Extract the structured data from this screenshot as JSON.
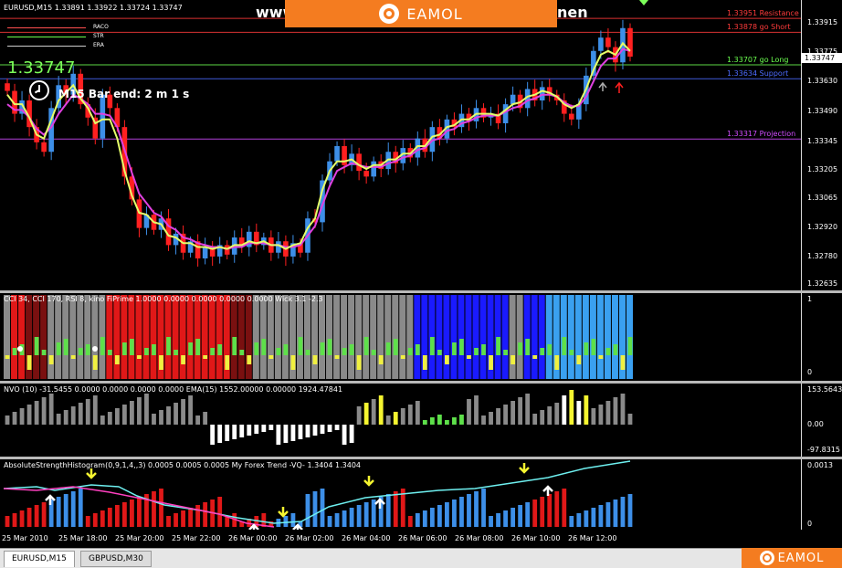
{
  "main": {
    "header": "EURUSD,M15  1.33891 1.33922 1.33724 1.33747",
    "big_price": "1.33747",
    "bar_end": "M15 Bar end: 2 m 1 s",
    "last_price_tag": "1.33747",
    "legend_items": [
      "RACO",
      "STR",
      "ERA"
    ],
    "levels": [
      {
        "label": "1.33951 Resistance",
        "value": 1.33951,
        "color": "#ff3b3b"
      },
      {
        "label": "1.33878 go Short",
        "value": 1.33878,
        "color": "#ff3b3b"
      },
      {
        "label": "1.33707 go Long",
        "value": 1.33707,
        "color": "#6bff4f"
      },
      {
        "label": "1.33634 Support",
        "value": 1.33634,
        "color": "#4d6bff"
      },
      {
        "label": "1.33317 Projection",
        "value": 1.33317,
        "color": "#d14cff"
      }
    ],
    "ticks": [
      "1.33915",
      "1.33775",
      "1.33630",
      "1.33490",
      "1.33345",
      "1.33205",
      "1.33065",
      "1.32920",
      "1.32780",
      "1.32635"
    ]
  },
  "watermark": {
    "url_left": "www",
    "url_right": "nen",
    "brand": "EAMOL"
  },
  "cci": {
    "title": "CCI 34, CCI 170, RSI 8, kino FiPrime  1.0000 0.0000 0.0000 0.0000 0.0000  Wick 3.1 -2.3",
    "ticks": [
      "1",
      "0"
    ]
  },
  "nvo": {
    "title": "NVO (10) -31.5455 0.0000 0.0000 0.0000 0.0000  EMA(15) 1552.00000 0.00000 1924.47841",
    "ticks": [
      "153.5643",
      "0.00",
      "-97.8315"
    ]
  },
  "ash": {
    "title": "AbsoluteStrengthHistogram(0,9,1,4,,3) 0.0005 0.0005 0.0005  My Forex Trend -VQ- 1.3404 1.3404",
    "ticks": [
      "0.0013",
      "0"
    ]
  },
  "time_axis": [
    "25 Mar 2010",
    "25 Mar 18:00",
    "25 Mar 20:00",
    "25 Mar 22:00",
    "26 Mar 00:00",
    "26 Mar 02:00",
    "26 Mar 04:00",
    "26 Mar 06:00",
    "26 Mar 08:00",
    "26 Mar 10:00",
    "26 Mar 12:00"
  ],
  "tabs": [
    {
      "label": "EURUSD,M15",
      "active": true
    },
    {
      "label": "GBPUSD,M30",
      "active": false
    }
  ],
  "chart_data": {
    "type": "candlestick",
    "symbol": "EURUSD",
    "timeframe": "M15",
    "ylim": [
      1.3257,
      1.3399
    ],
    "closes": [
      1.3357,
      1.3345,
      1.3352,
      1.3338,
      1.333,
      1.3325,
      1.3348,
      1.336,
      1.3355,
      1.3366,
      1.335,
      1.3343,
      1.3332,
      1.3355,
      1.3348,
      1.3338,
      1.3312,
      1.33,
      1.3285,
      1.3292,
      1.3284,
      1.329,
      1.3276,
      1.3282,
      1.3272,
      1.3278,
      1.3269,
      1.3275,
      1.327,
      1.3276,
      1.3271,
      1.328,
      1.3275,
      1.3283,
      1.3276,
      1.328,
      1.3272,
      1.3278,
      1.327,
      1.3277,
      1.3272,
      1.329,
      1.3288,
      1.331,
      1.332,
      1.3328,
      1.3318,
      1.3324,
      1.3315,
      1.3312,
      1.332,
      1.3316,
      1.3325,
      1.3319,
      1.3327,
      1.3322,
      1.3332,
      1.3325,
      1.3338,
      1.3332,
      1.3342,
      1.3338,
      1.3345,
      1.3341,
      1.3348,
      1.3343,
      1.3345,
      1.334,
      1.335,
      1.3355,
      1.3348,
      1.3358,
      1.3352,
      1.3359,
      1.3355,
      1.3352,
      1.3345,
      1.3342,
      1.335,
      1.3365,
      1.3378,
      1.3385,
      1.338,
      1.3372,
      1.339,
      1.3375
    ],
    "ema_fast": [
      1.3355,
      1.335,
      1.335,
      1.3343,
      1.3334,
      1.3332,
      1.3342,
      1.3352,
      1.3356,
      1.336,
      1.3353,
      1.3348,
      1.334,
      1.3342,
      1.3342,
      1.3332,
      1.3315,
      1.3302,
      1.3293,
      1.3292,
      1.3288,
      1.3287,
      1.3281,
      1.328,
      1.3277,
      1.3277,
      1.3275,
      1.3275,
      1.3274,
      1.3275,
      1.3274,
      1.3276,
      1.3276,
      1.3278,
      1.3277,
      1.3278,
      1.3276,
      1.3276,
      1.3274,
      1.3276,
      1.3277,
      1.3285,
      1.329,
      1.3305,
      1.3315,
      1.332,
      1.332,
      1.3321,
      1.3318,
      1.3316,
      1.3318,
      1.3318,
      1.3321,
      1.3321,
      1.3324,
      1.3324,
      1.3328,
      1.3328,
      1.3333,
      1.3334,
      1.3338,
      1.3339,
      1.3342,
      1.3342,
      1.3345,
      1.3345,
      1.3345,
      1.3344,
      1.3347,
      1.335,
      1.3351,
      1.3354,
      1.3355,
      1.3357,
      1.3356,
      1.3354,
      1.335,
      1.3348,
      1.335,
      1.3358,
      1.3368,
      1.3376,
      1.3378,
      1.3376,
      1.3382,
      1.3378
    ],
    "ema_slow": [
      1.335,
      1.3347,
      1.3347,
      1.3343,
      1.3337,
      1.3334,
      1.3338,
      1.3345,
      1.335,
      1.3355,
      1.3353,
      1.335,
      1.3345,
      1.3345,
      1.3344,
      1.3338,
      1.3326,
      1.3314,
      1.3303,
      1.3298,
      1.3293,
      1.3291,
      1.3286,
      1.3284,
      1.328,
      1.3279,
      1.3277,
      1.3276,
      1.3275,
      1.3275,
      1.3274,
      1.3275,
      1.3275,
      1.3277,
      1.3277,
      1.3277,
      1.3276,
      1.3276,
      1.3275,
      1.3275,
      1.3276,
      1.3281,
      1.3286,
      1.3297,
      1.3307,
      1.3315,
      1.3317,
      1.3319,
      1.3318,
      1.3317,
      1.3317,
      1.3317,
      1.3319,
      1.332,
      1.3322,
      1.3323,
      1.3326,
      1.3327,
      1.3331,
      1.3332,
      1.3336,
      1.3337,
      1.334,
      1.3341,
      1.3343,
      1.3344,
      1.3344,
      1.3344,
      1.3346,
      1.3348,
      1.3349,
      1.3352,
      1.3353,
      1.3355,
      1.3355,
      1.3354,
      1.3351,
      1.3349,
      1.3349,
      1.3354,
      1.3362,
      1.337,
      1.3374,
      1.3374,
      1.3379,
      1.3378
    ]
  }
}
